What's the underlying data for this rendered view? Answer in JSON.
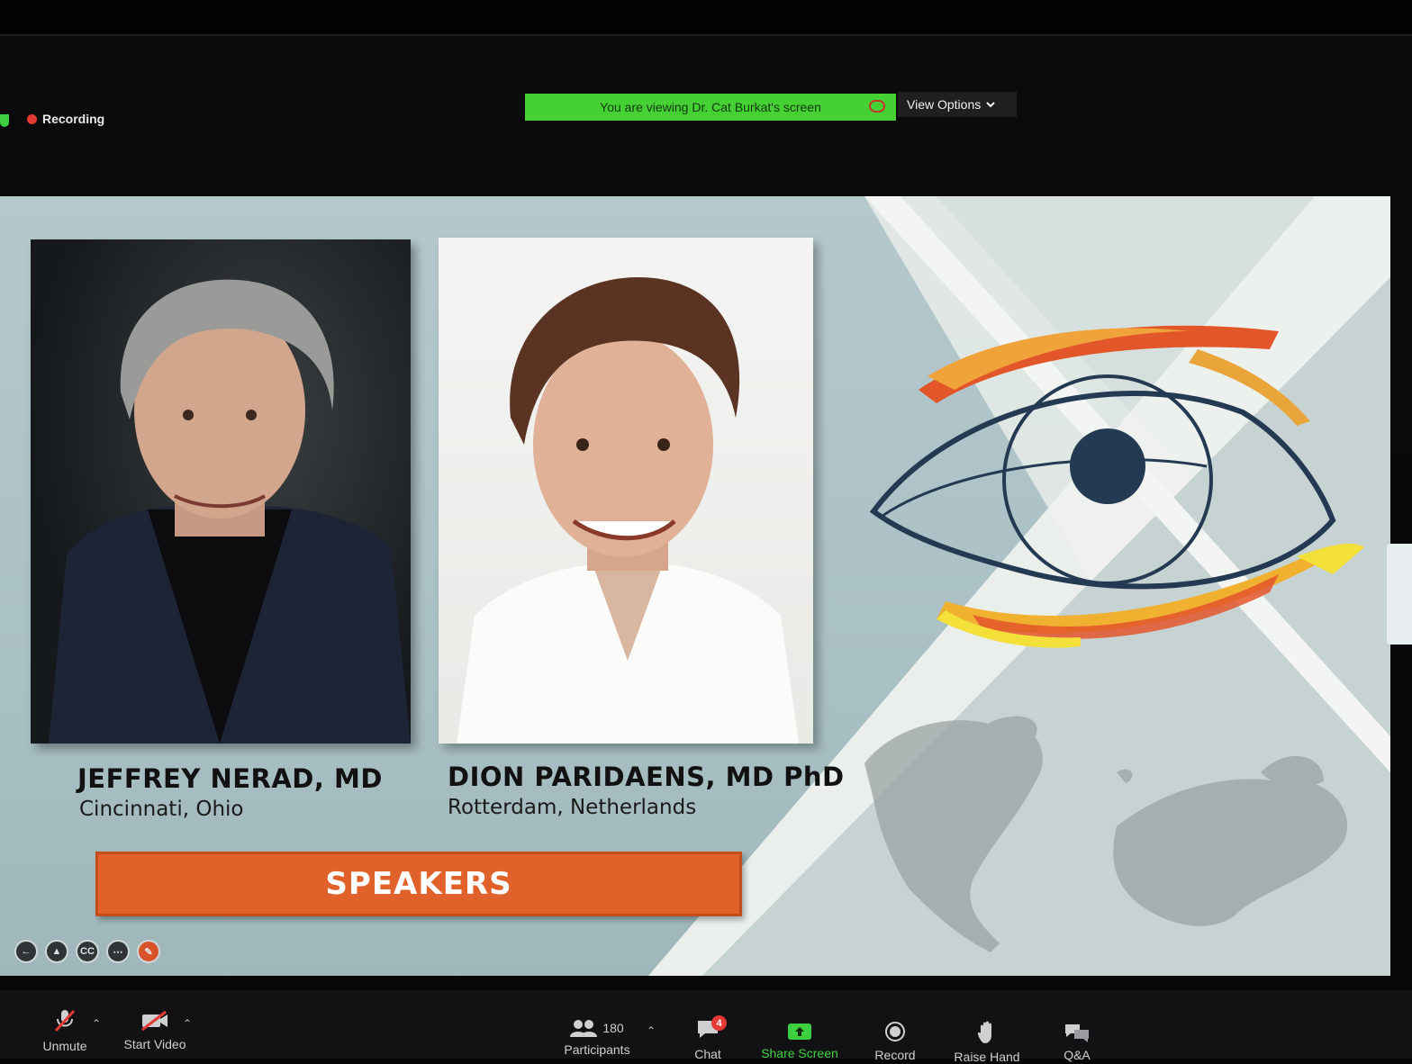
{
  "status": {
    "recording_label": "Recording"
  },
  "share_banner": {
    "text": "You are viewing Dr. Cat Burkat's screen",
    "view_options_label": "View Options"
  },
  "slide": {
    "speakers": [
      {
        "name": "JEFFREY NERAD, MD",
        "location": "Cincinnati, Ohio"
      },
      {
        "name": "DION PARIDAENS, MD PhD",
        "location": "Rotterdam, Netherlands"
      }
    ],
    "banner_label": "SPEAKERS",
    "controls": [
      "back-icon",
      "pointer-icon",
      "captions-icon",
      "more-icon",
      "pen-icon"
    ],
    "controls_cc_label": "CC",
    "colors": {
      "accent_orange": "#e1612a",
      "slide_bg": "#b5c9cd"
    }
  },
  "toolbar": {
    "unmute_label": "Unmute",
    "start_video_label": "Start Video",
    "participants_count": "180",
    "participants_label": "Participants",
    "chat_label": "Chat",
    "chat_badge": "4",
    "share_screen_label": "Share Screen",
    "record_label": "Record",
    "raise_hand_label": "Raise Hand",
    "qa_label": "Q&A"
  }
}
